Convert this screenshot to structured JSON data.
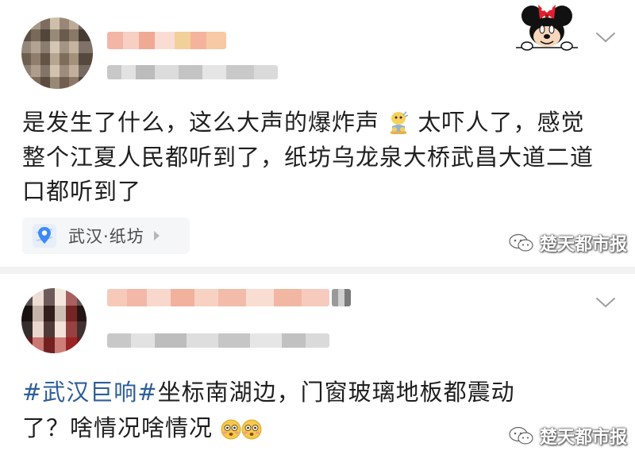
{
  "post1": {
    "text_lines": [
      "是发生了什么，这么大声的爆炸声",
      "太吓人了，感觉",
      "整个江夏人民都听到了，纸坊乌龙泉大桥武昌大道二道",
      "口都听到了"
    ],
    "location_label": "武汉·纸坊",
    "watermark": "楚天都市报"
  },
  "post2": {
    "topic": "#武汉巨响#",
    "text_line1_rest": "坐标南湖边，门窗玻璃地板都震动",
    "text_line2": "了？啥情况啥情况",
    "watermark": "楚天都市报"
  },
  "icons": {
    "expand": "chevron-down-icon",
    "location": "location-pin-icon",
    "emoji_scared": "scared-emoji-icon",
    "emoji_flushed": "flushed-face-emoji-icon",
    "watermark": "wechat-icon",
    "sticker": "minnie-mouse-sticker"
  },
  "colors": {
    "topic": "#2d5d9a",
    "text": "#1f1f1f",
    "divider": "#f2f2f2"
  }
}
